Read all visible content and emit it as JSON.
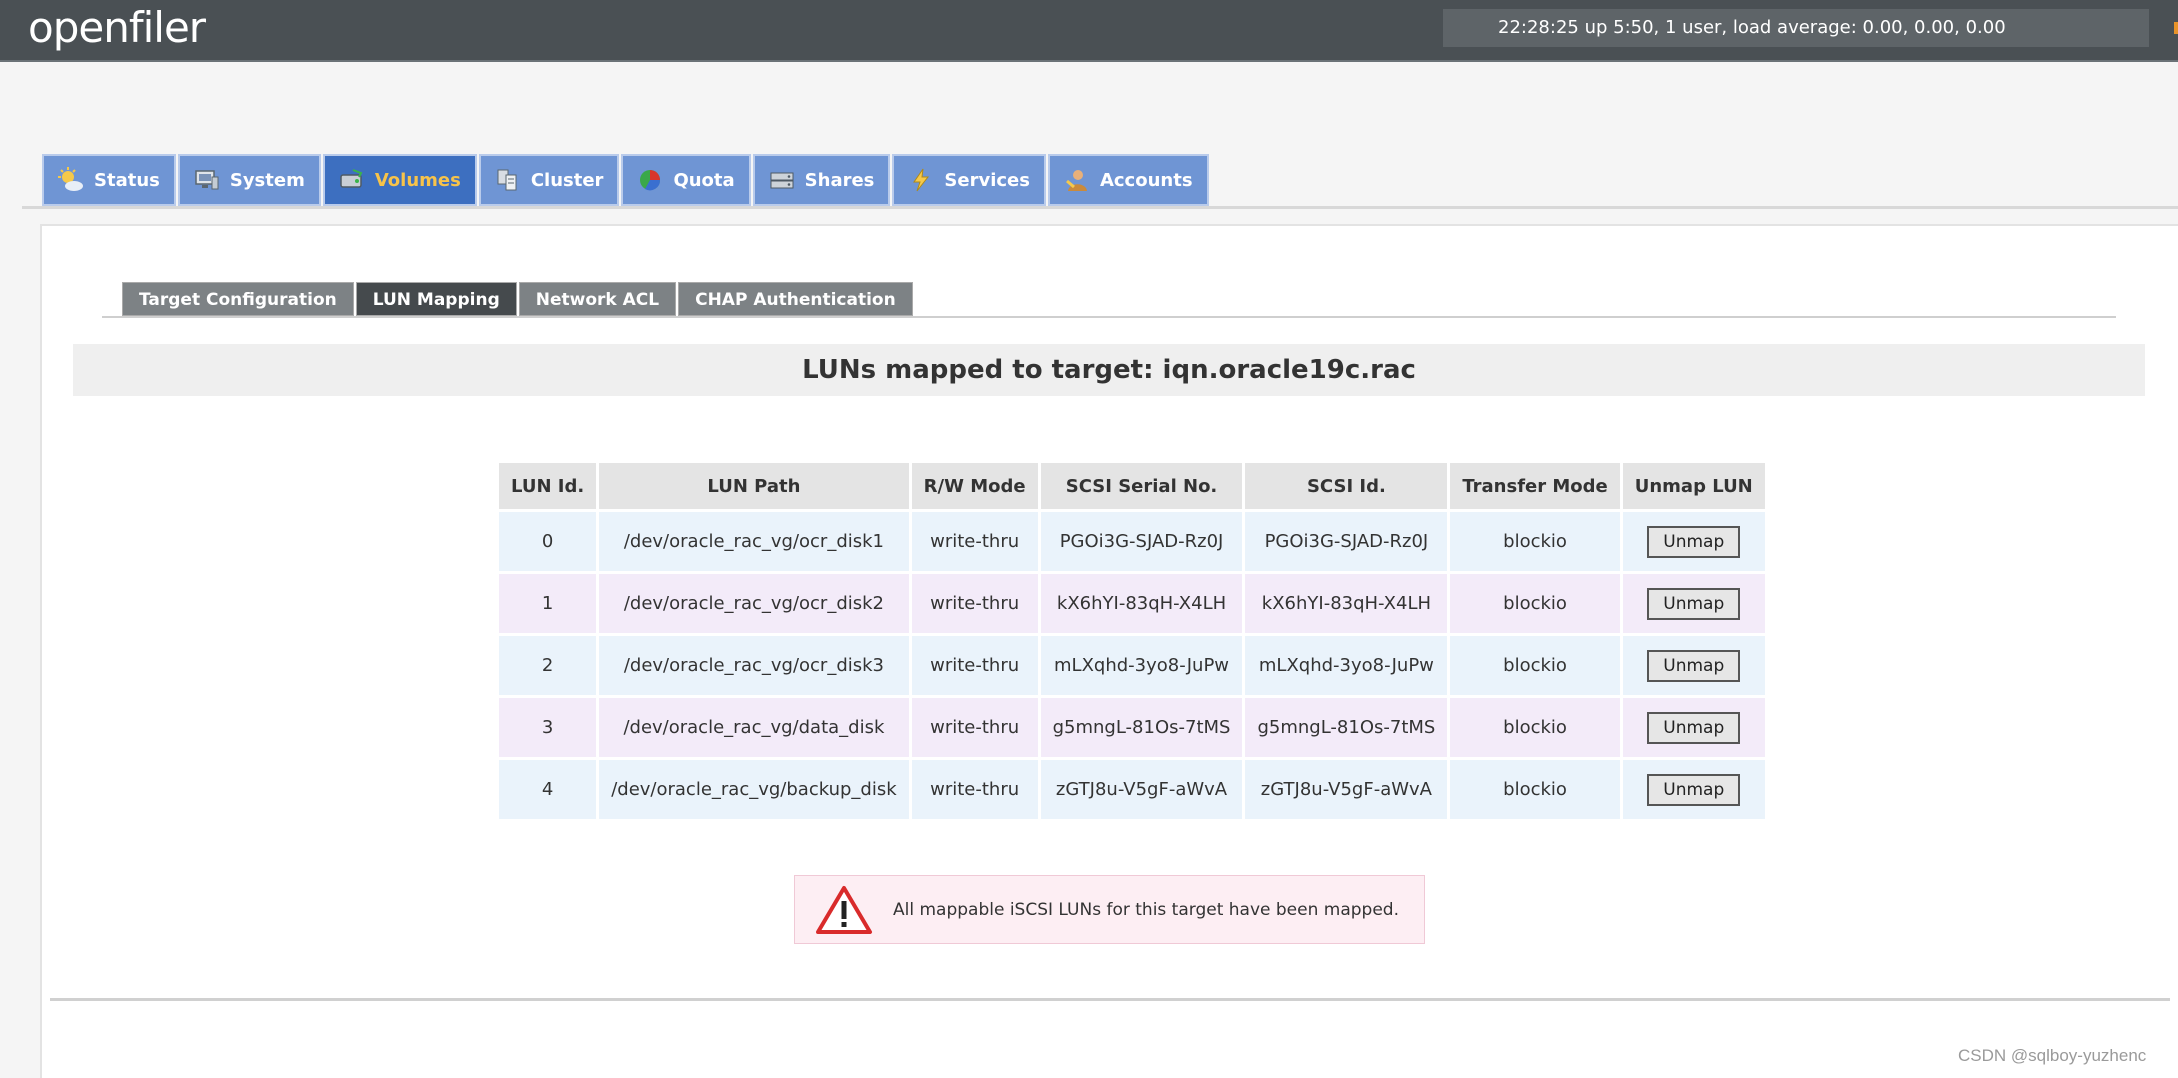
{
  "header": {
    "logo": "openfiler",
    "uptime": "22:28:25 up 5:50, 1 user, load average: 0.00, 0.00, 0.00"
  },
  "main_tabs": [
    {
      "label": "Status",
      "icon": "sun-icon"
    },
    {
      "label": "System",
      "icon": "monitor-icon"
    },
    {
      "label": "Volumes",
      "icon": "drive-icon"
    },
    {
      "label": "Cluster",
      "icon": "cluster-icon"
    },
    {
      "label": "Quota",
      "icon": "pie-chart-icon"
    },
    {
      "label": "Shares",
      "icon": "shares-icon"
    },
    {
      "label": "Services",
      "icon": "lightning-icon"
    },
    {
      "label": "Accounts",
      "icon": "accounts-icon"
    }
  ],
  "active_main_tab": "Volumes",
  "sub_tabs": [
    "Target Configuration",
    "LUN Mapping",
    "Network ACL",
    "CHAP Authentication"
  ],
  "active_sub_tab": "LUN Mapping",
  "page_title": "LUNs mapped to target: iqn.oracle19c.rac",
  "table": {
    "headers": [
      "LUN Id.",
      "LUN Path",
      "R/W Mode",
      "SCSI Serial No.",
      "SCSI Id.",
      "Transfer Mode",
      "Unmap LUN"
    ],
    "rows": [
      {
        "id": "0",
        "path": "/dev/oracle_rac_vg/ocr_disk1",
        "mode": "write-thru",
        "serial": "PGOi3G-SJAD-Rz0J",
        "scsi_id": "PGOi3G-SJAD-Rz0J",
        "transfer": "blockio",
        "action": "Unmap"
      },
      {
        "id": "1",
        "path": "/dev/oracle_rac_vg/ocr_disk2",
        "mode": "write-thru",
        "serial": "kX6hYI-83qH-X4LH",
        "scsi_id": "kX6hYI-83qH-X4LH",
        "transfer": "blockio",
        "action": "Unmap"
      },
      {
        "id": "2",
        "path": "/dev/oracle_rac_vg/ocr_disk3",
        "mode": "write-thru",
        "serial": "mLXqhd-3yo8-JuPw",
        "scsi_id": "mLXqhd-3yo8-JuPw",
        "transfer": "blockio",
        "action": "Unmap"
      },
      {
        "id": "3",
        "path": "/dev/oracle_rac_vg/data_disk",
        "mode": "write-thru",
        "serial": "g5mngL-81Os-7tMS",
        "scsi_id": "g5mngL-81Os-7tMS",
        "transfer": "blockio",
        "action": "Unmap"
      },
      {
        "id": "4",
        "path": "/dev/oracle_rac_vg/backup_disk",
        "mode": "write-thru",
        "serial": "zGTJ8u-V5gF-aWvA",
        "scsi_id": "zGTJ8u-V5gF-aWvA",
        "transfer": "blockio",
        "action": "Unmap"
      }
    ]
  },
  "notice": {
    "icon": "warning-icon",
    "message": "All mappable iSCSI LUNs for this target have been mapped."
  },
  "watermark": "CSDN @sqlboy-yuzhenc",
  "colors": {
    "header_bg": "#4a5054",
    "tab_bg": "#6f95d4",
    "tab_active_bg": "#3d6fc0",
    "tab_active_text": "#f7c34a",
    "subtab_bg": "#7d8285",
    "subtab_active_bg": "#454a4d",
    "row_odd": "#eaf3fb",
    "row_even": "#f3ebf9",
    "notice_bg": "#fdeef3"
  }
}
